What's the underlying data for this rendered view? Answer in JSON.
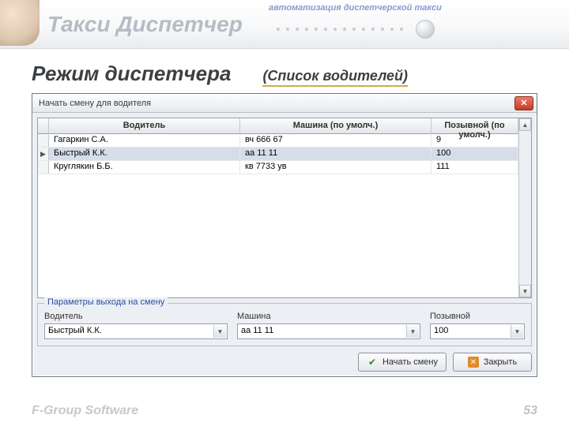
{
  "header": {
    "brand": "Такси Диспетчер",
    "tagline": "автоматизация диспетчерской такси"
  },
  "page": {
    "heading": "Режим диспетчера",
    "subheading": "(Список водителей)"
  },
  "window": {
    "title": "Начать смену для водителя",
    "grid": {
      "columns": [
        "Водитель",
        "Машина (по умолч.)",
        "Позывной (по умолч.)"
      ],
      "rows": [
        {
          "driver": "Гагаркин С.А.",
          "car": "вч 666 67",
          "callsign": "9",
          "selected": false
        },
        {
          "driver": "Быстрый К.К.",
          "car": "аа 11 11",
          "callsign": "100",
          "selected": true
        },
        {
          "driver": "Круглякин Б.Б.",
          "car": "кв 7733 ув",
          "callsign": "111",
          "selected": false
        }
      ]
    },
    "params": {
      "title": "Параметры выхода на смену",
      "driver_label": "Водитель",
      "driver_value": "Быстрый К.К.",
      "car_label": "Машина",
      "car_value": "аа 11 11",
      "callsign_label": "Позывной",
      "callsign_value": "100"
    },
    "buttons": {
      "start": "Начать смену",
      "close": "Закрыть"
    }
  },
  "footer": {
    "vendor": "F-Group Software",
    "page_number": "53"
  }
}
